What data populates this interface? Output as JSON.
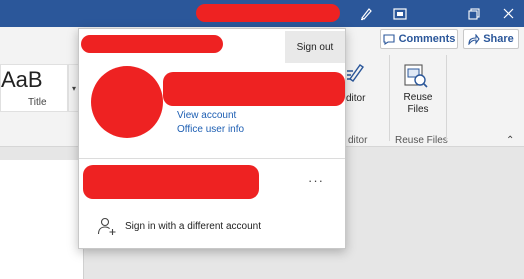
{
  "colors": {
    "titlebar": "#2b579a",
    "accent": "#2b579a",
    "link": "#1e5fb3",
    "redaction": "#ee2222"
  },
  "titlebar": {
    "icons": [
      "pen-icon",
      "restore-window-icon",
      "maximize-icon",
      "close-icon"
    ]
  },
  "ribbon": {
    "comments_label": "Comments",
    "share_label": "Share",
    "style_sample": "AaB",
    "style_name": "Title",
    "editor_label": "ditor",
    "editor_group_label": "ditor",
    "reuse_files_label": "Reuse Files",
    "reuse_files_group_label": "Reuse Files"
  },
  "account_popup": {
    "sign_out_label": "Sign out",
    "view_account_label": "View account",
    "office_user_info_label": "Office user info",
    "more_options_label": "···",
    "sign_in_different_label": "Sign in with a different account"
  }
}
